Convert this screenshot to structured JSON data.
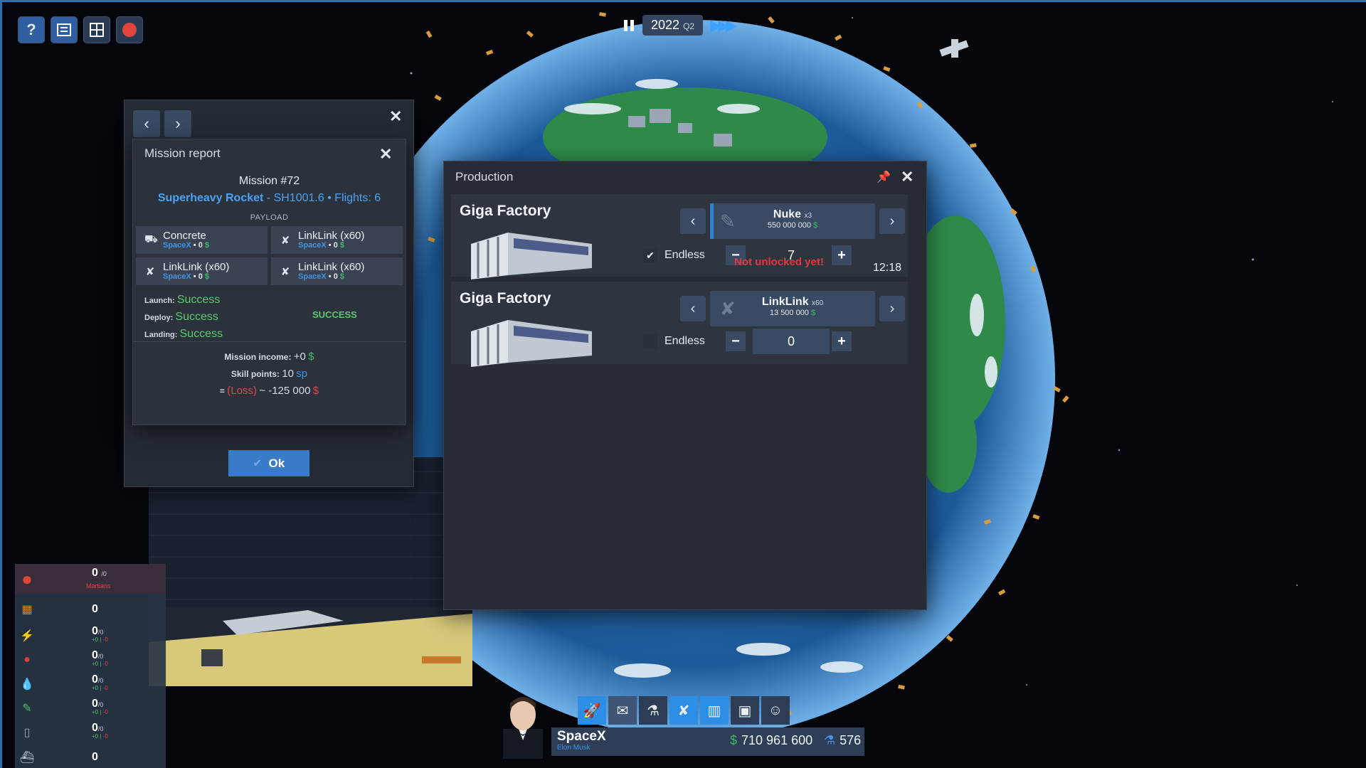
{
  "top_toolbar": [
    {
      "name": "help-button",
      "label": "?",
      "icon": "question-mark-icon"
    },
    {
      "name": "list-button",
      "label": "",
      "icon": "list-icon"
    },
    {
      "name": "grid-button",
      "label": "",
      "icon": "grid-icon"
    },
    {
      "name": "mars-button",
      "label": "",
      "icon": "mars-icon"
    }
  ],
  "time": {
    "year": "2022",
    "quarter": "Q2"
  },
  "mission_report": {
    "title": "Mission report",
    "mission": "Mission #72",
    "rocket": "Superheavy Rocket",
    "rocket_id": " - SH1001.6 • ",
    "flights": "Flights: 6",
    "payload_header": "PAYLOAD",
    "payload": [
      {
        "name": "Concrete",
        "owner": "SpaceX",
        "value": "0"
      },
      {
        "name": "LinkLink (x60)",
        "owner": "SpaceX",
        "value": "0"
      },
      {
        "name": "LinkLink (x60)",
        "owner": "SpaceX",
        "value": "0"
      },
      {
        "name": "LinkLink (x60)",
        "owner": "SpaceX",
        "value": "0"
      }
    ],
    "launch_label": "Launch:",
    "launch": "Success",
    "deploy_label": "Deploy:",
    "deploy": "Success",
    "landing_label": "Landing:",
    "landing": "Success",
    "overall": "SUCCESS",
    "income_label": "Mission income:",
    "income_value": "+0",
    "skill_label": "Skill points:",
    "skill_value": "10",
    "skill_unit": "sp",
    "loss_prefix": "= ",
    "loss_label": "(Loss)",
    "loss_value": "~ -125 000",
    "currency": "$",
    "ok_label": "Ok"
  },
  "production": {
    "title": "Production",
    "items": [
      {
        "factory": "Giga Factory",
        "product": "Nuke",
        "product_mult": "x3",
        "price": "550 000 000",
        "endless_label": "Endless",
        "endless_checked": true,
        "quantity": "7",
        "warning": "Not unlocked yet!",
        "timer": "12:18"
      },
      {
        "factory": "Giga Factory",
        "product": "LinkLink",
        "product_mult": "x60",
        "price": "13 500 000",
        "endless_label": "Endless",
        "endless_checked": false,
        "quantity": "0"
      }
    ]
  },
  "resources": {
    "martians": {
      "value": "0",
      "cap": "/0",
      "label": "Martians"
    },
    "rows": [
      {
        "icon": "building-materials-icon",
        "value": "0"
      },
      {
        "icon": "energy-icon",
        "value": "0",
        "cap": "/0",
        "plus": "+0",
        "minus": "-0"
      },
      {
        "icon": "food-icon",
        "value": "0",
        "cap": "/0",
        "plus": "+0",
        "minus": "-0"
      },
      {
        "icon": "water-icon",
        "value": "0",
        "cap": "/0",
        "plus": "+0",
        "minus": "-0"
      },
      {
        "icon": "medicine-icon",
        "value": "0",
        "cap": "/0",
        "plus": "+0",
        "minus": "-0"
      },
      {
        "icon": "oxygen-icon",
        "value": "0",
        "cap": "/0",
        "plus": "+0",
        "minus": "-0"
      },
      {
        "icon": "vehicle-icon",
        "value": "0"
      }
    ]
  },
  "bottom_bar": {
    "icons": [
      "rocket-icon",
      "contracts-icon",
      "research-icon",
      "satellite-icon",
      "factory-icon",
      "briefcase-icon",
      "personnel-icon"
    ],
    "company": "SpaceX",
    "ceo": "Elon Musk",
    "money": "710 961 600",
    "science": "576"
  },
  "colors": {
    "accent": "#2d8ee6",
    "success": "#5ac96e",
    "loss": "#e0464b",
    "panel": "#252a33"
  }
}
